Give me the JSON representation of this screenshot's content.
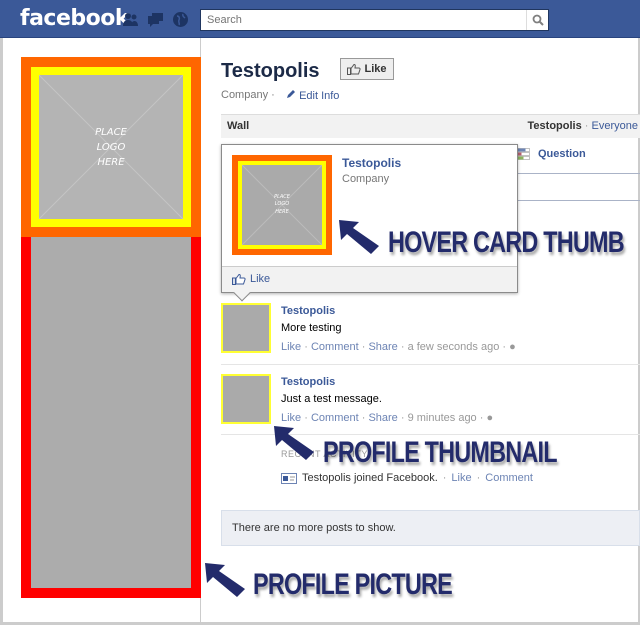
{
  "topbar": {
    "logo": "facebook",
    "icons": [
      "friend-requests-icon",
      "messages-icon",
      "notifications-icon"
    ],
    "search_placeholder": "Search"
  },
  "profile": {
    "logo_placeholder": "PLACE\nLOGO\nHERE",
    "colors": {
      "outer": "#ff0000",
      "logo_frame": "#ff6600",
      "logo_inner": "#ffff00",
      "image": "#acacac"
    }
  },
  "header": {
    "title": "Testopolis",
    "like_label": "Like",
    "category": "Company",
    "separator": "·",
    "edit_info": "Edit Info"
  },
  "wall": {
    "label": "Wall",
    "filter_name": "Testopolis",
    "filter_sep": "·",
    "filter_option": "Everyone"
  },
  "composer": {
    "question_label": "Question"
  },
  "hovercard": {
    "name": "Testopolis",
    "category": "Company",
    "thumb_placeholder": "PLACE\nLOGO\nHERE",
    "like_label": "Like"
  },
  "posts": [
    {
      "author": "Testopolis",
      "text": "More testing",
      "actions": [
        "Like",
        "Comment",
        "Share"
      ],
      "time": "a few seconds ago"
    },
    {
      "author": "Testopolis",
      "text": "Just a test message.",
      "actions": [
        "Like",
        "Comment",
        "Share"
      ],
      "time": "9 minutes ago"
    }
  ],
  "recent_activity": {
    "label": "RECENT ACTIVITY",
    "item_text": "Testopolis joined Facebook.",
    "actions": [
      "Like",
      "Comment"
    ]
  },
  "no_more_posts": "There are no more posts to show.",
  "callouts": {
    "hover_card_thumb": "HOVER CARD THUMB",
    "profile_thumbnail": "PROFILE THUMBNAIL",
    "profile_picture": "PROFILE PICTURE",
    "color": "#232b6b"
  }
}
